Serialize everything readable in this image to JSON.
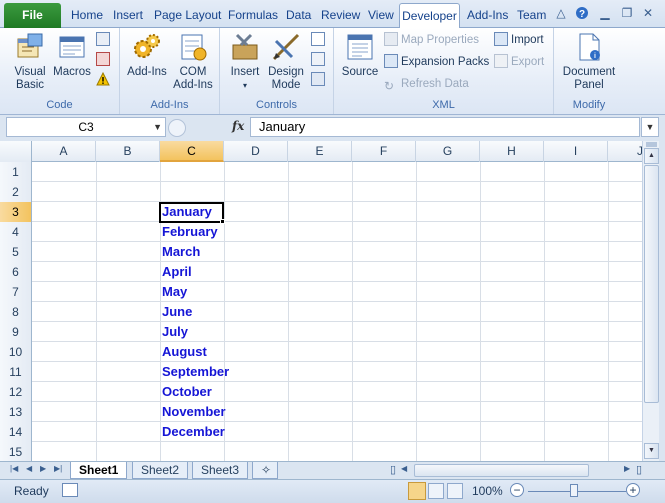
{
  "tabs": {
    "file": "File",
    "items": [
      "Home",
      "Insert",
      "Page Layout",
      "Formulas",
      "Data",
      "Review",
      "View",
      "Developer",
      "Add-Ins",
      "Team"
    ],
    "active": "Developer"
  },
  "ribbon": {
    "code": {
      "label": "Code",
      "visual_basic": "Visual Basic",
      "macros": "Macros"
    },
    "addins": {
      "label": "Add-Ins",
      "addins": "Add-Ins",
      "com_addins": "COM Add-Ins"
    },
    "controls": {
      "label": "Controls",
      "insert": "Insert",
      "design_mode": "Design Mode"
    },
    "xml": {
      "label": "XML",
      "source": "Source",
      "map_properties": "Map Properties",
      "expansion_packs": "Expansion Packs",
      "refresh_data": "Refresh Data",
      "import": "Import",
      "export": "Export"
    },
    "modify": {
      "label": "Modify",
      "document_panel": "Document Panel"
    }
  },
  "formula_bar": {
    "name_box": "C3",
    "fx": "fx",
    "content": "January"
  },
  "grid": {
    "columns": [
      "A",
      "B",
      "C",
      "D",
      "E",
      "F",
      "G",
      "H",
      "I",
      "J"
    ],
    "rows": [
      "1",
      "2",
      "3",
      "4",
      "5",
      "6",
      "7",
      "8",
      "9",
      "10",
      "11",
      "12",
      "13",
      "14",
      "15"
    ],
    "selected_column": "C",
    "selected_row": "3",
    "column_c_values": [
      "",
      "",
      "January",
      "February",
      "March",
      "April",
      "May",
      "June",
      "July",
      "August",
      "September",
      "October",
      "November",
      "December",
      ""
    ],
    "text_color": "#1515d6"
  },
  "sheets": {
    "tabs": [
      "Sheet1",
      "Sheet2",
      "Sheet3"
    ],
    "active": "Sheet1"
  },
  "status": {
    "ready": "Ready",
    "zoom": "100%"
  }
}
